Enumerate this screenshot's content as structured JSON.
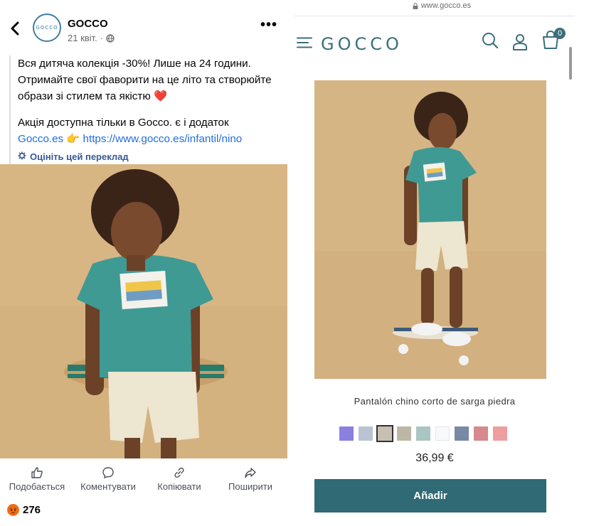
{
  "facebook": {
    "page_name": "GOCCO",
    "avatar_text": "GOCCO",
    "date": "21 квіт.",
    "date_separator": "·",
    "post_lines": [
      "Вся дитяча колекція -30%! Лише на 24 години.",
      "Отримайте свої фаворити на це літо та створюйте",
      "образи зі стилем та якістю"
    ],
    "heart_emoji": "❤️",
    "post_line_4": "Акція доступна тільки в Gocco. є і додаток",
    "post_link_1": "Gocco.es",
    "pointing_emoji": "👉",
    "post_link_2": "https://www.gocco.es/infantil/nino",
    "translate_label": "Оцініть цей переклад",
    "actions": {
      "like": "Подобається",
      "comment": "Коментувати",
      "copy": "Копіювати",
      "share": "Поширити"
    },
    "reaction_count": "276"
  },
  "site": {
    "url": "www.gocco.es",
    "logo": "GOCCO",
    "cart_count": "0",
    "product_name": "Pantalón chino corto de sarga piedra",
    "price": "36,99 €",
    "add_button": "Añadir",
    "swatch_colors": [
      "#8a80e0",
      "#b9c3d3",
      "#c9bfb3",
      "#bdb8a6",
      "#a9c6c3",
      "#f8f9fb",
      "#7889a6",
      "#d7898d",
      "#ee9ea0"
    ],
    "selected_swatch_index": 2
  },
  "colors": {
    "brand_teal": "#2f6a75",
    "facebook_link": "#216fdb"
  }
}
